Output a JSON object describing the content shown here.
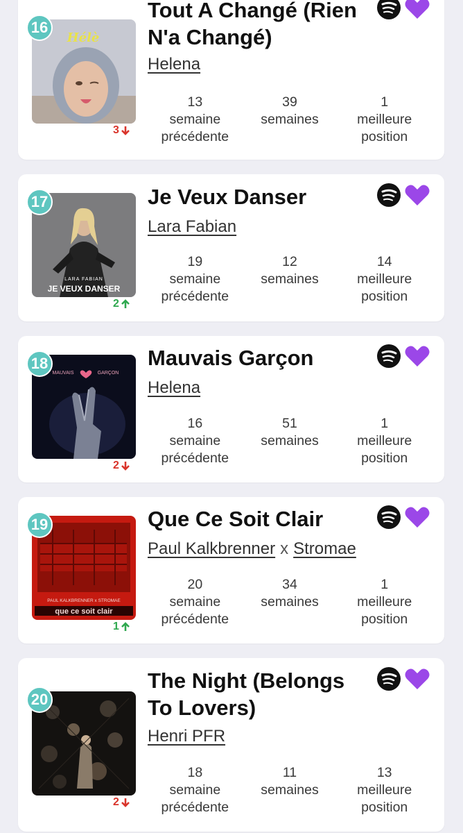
{
  "colors": {
    "background": "#eeeef4",
    "rank_badge": "#5ec6c0",
    "down": "#d9342b",
    "up": "#2fa84f",
    "heart": "#9b47e8",
    "spotify": "#111111"
  },
  "entries": [
    {
      "rank": "16",
      "title": "Tout A Changé (Rien N'a Changé)",
      "artists": [
        "Helena"
      ],
      "separator": "",
      "cover_text": "Hélè",
      "movement": {
        "value": "3",
        "direction": "down"
      },
      "stats": {
        "prev_value": "13",
        "prev_label_1": "semaine",
        "prev_label_2": "précédente",
        "weeks_value": "39",
        "weeks_label": "semaines",
        "best_value": "1",
        "best_label_1": "meilleure",
        "best_label_2": "position"
      }
    },
    {
      "rank": "17",
      "title": "Je Veux Danser",
      "artists": [
        "Lara Fabian"
      ],
      "separator": "",
      "cover_text": "LARA FABIAN",
      "cover_text_2": "JE VEUX DANSER",
      "movement": {
        "value": "2",
        "direction": "up"
      },
      "stats": {
        "prev_value": "19",
        "prev_label_1": "semaine",
        "prev_label_2": "précédente",
        "weeks_value": "12",
        "weeks_label": "semaines",
        "best_value": "14",
        "best_label_1": "meilleure",
        "best_label_2": "position"
      }
    },
    {
      "rank": "18",
      "title": "Mauvais Garçon",
      "artists": [
        "Helena"
      ],
      "separator": "",
      "cover_text": "MAUVAIS",
      "cover_text_2": "GARÇON",
      "movement": {
        "value": "2",
        "direction": "down"
      },
      "stats": {
        "prev_value": "16",
        "prev_label_1": "semaine",
        "prev_label_2": "précédente",
        "weeks_value": "51",
        "weeks_label": "semaines",
        "best_value": "1",
        "best_label_1": "meilleure",
        "best_label_2": "position"
      }
    },
    {
      "rank": "19",
      "title": "Que Ce Soit Clair",
      "artists": [
        "Paul Kalkbrenner",
        "Stromae"
      ],
      "separator": "x",
      "cover_text": "PAUL KALKBRENNER x STROMAE",
      "cover_text_2": "que ce soit clair",
      "movement": {
        "value": "1",
        "direction": "up"
      },
      "stats": {
        "prev_value": "20",
        "prev_label_1": "semaine",
        "prev_label_2": "précédente",
        "weeks_value": "34",
        "weeks_label": "semaines",
        "best_value": "1",
        "best_label_1": "meilleure",
        "best_label_2": "position"
      }
    },
    {
      "rank": "20",
      "title": "The Night (Belongs To Lovers)",
      "artists": [
        "Henri PFR"
      ],
      "separator": "",
      "cover_text": "",
      "movement": {
        "value": "2",
        "direction": "down"
      },
      "stats": {
        "prev_value": "18",
        "prev_label_1": "semaine",
        "prev_label_2": "précédente",
        "weeks_value": "11",
        "weeks_label": "semaines",
        "best_value": "13",
        "best_label_1": "meilleure",
        "best_label_2": "position"
      }
    }
  ]
}
